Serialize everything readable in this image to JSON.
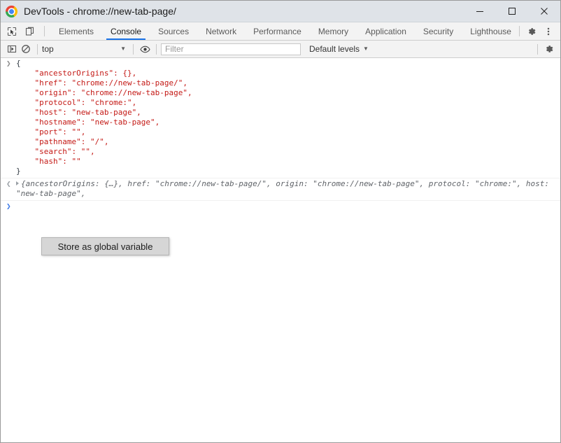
{
  "window": {
    "title": "DevTools - chrome://new-tab-page/",
    "logo_icon": "chrome-logo-icon",
    "minimize_label": "—",
    "maximize_label": "□",
    "close_label": "✕"
  },
  "tabbar": {
    "inspect_icon": "inspect-element-icon",
    "device_icon": "device-toolbar-icon",
    "tabs": [
      {
        "label": "Elements",
        "active": false
      },
      {
        "label": "Console",
        "active": true
      },
      {
        "label": "Sources",
        "active": false
      },
      {
        "label": "Network",
        "active": false
      },
      {
        "label": "Performance",
        "active": false
      },
      {
        "label": "Memory",
        "active": false
      },
      {
        "label": "Application",
        "active": false
      },
      {
        "label": "Security",
        "active": false
      },
      {
        "label": "Lighthouse",
        "active": false
      }
    ],
    "settings_icon": "gear-icon",
    "more_icon": "more-vertical-icon"
  },
  "console_toolbar": {
    "sidebar_icon": "console-sidebar-icon",
    "clear_icon": "clear-console-icon",
    "context_value": "top",
    "context_caret": "▼",
    "eye_icon": "eye-icon",
    "filter_placeholder": "Filter",
    "filter_value": "",
    "levels_label": "Default levels",
    "levels_caret": "▼",
    "settings_icon": "gear-icon"
  },
  "console": {
    "input_arrow": "❯",
    "result_arrow": "❮",
    "prompt_arrow": "❯",
    "object_lines": [
      "{",
      "    \"ancestorOrigins\": {},",
      "    \"href\": \"chrome://new-tab-page/\",",
      "    \"origin\": \"chrome://new-tab-page\",",
      "    \"protocol\": \"chrome:\",",
      "    \"host\": \"new-tab-page\",",
      "    \"hostname\": \"new-tab-page\",",
      "    \"port\": \"\",",
      "    \"pathname\": \"/\",",
      "    \"search\": \"\",",
      "    \"hash\": \"\"",
      "}"
    ],
    "result_preview": "{ancestorOrigins: {…}, href: \"chrome://new-tab-page/\", origin: \"chrome://new-tab-page\", protocol: \"chrome:\", host: \"new-tab-page\","
  },
  "context_menu": {
    "items": [
      {
        "label": "Store as global variable"
      }
    ]
  },
  "colors": {
    "accent": "#1a73e8",
    "string": "#c41a16",
    "titlebar_bg": "#dfe3e8",
    "toolbar_bg": "#f3f3f3",
    "menu_bg": "#d6d6d6"
  }
}
